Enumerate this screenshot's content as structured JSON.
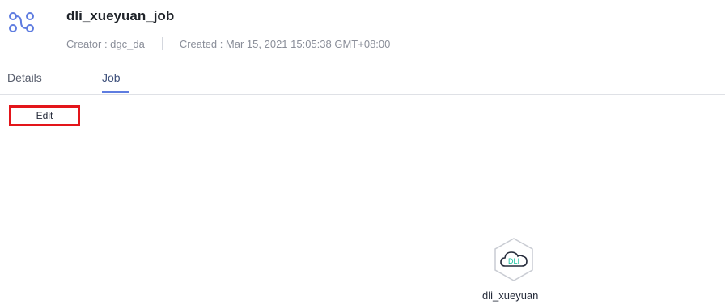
{
  "header": {
    "icon": "workflow-icon",
    "title": "dli_xueyuan_job",
    "creator": "Creator : dgc_da",
    "created": "Created : Mar 15, 2021 15:05:38 GMT+08:00"
  },
  "tabs": [
    {
      "label": "Details",
      "active": false
    },
    {
      "label": "Job",
      "active": true
    }
  ],
  "toolbar": {
    "edit_label": "Edit"
  },
  "canvas": {
    "node": {
      "icon": "dli-cloud-icon",
      "icon_text": "DLI",
      "label": "dli_xueyuan"
    }
  },
  "colors": {
    "accent": "#5e7ce0",
    "highlight_border": "#e3151a",
    "node_accent": "#1bc2a0"
  }
}
